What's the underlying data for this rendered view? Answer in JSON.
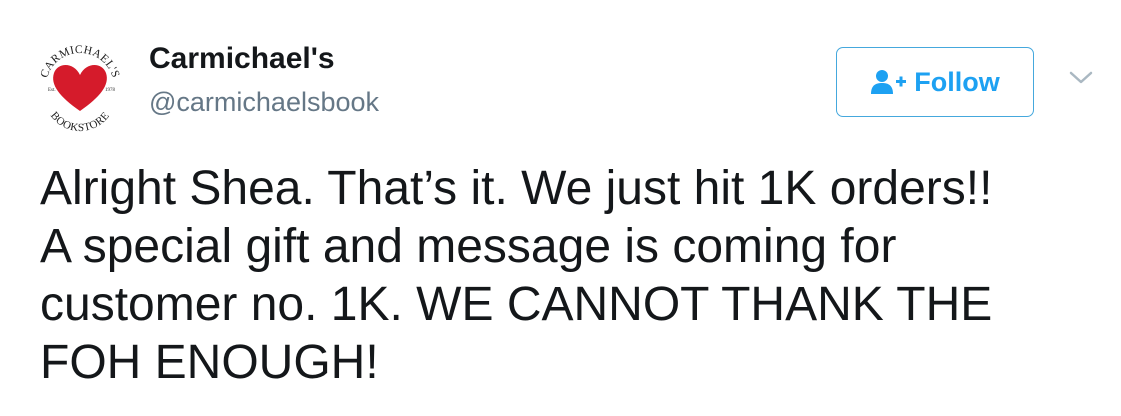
{
  "author": {
    "name": "Carmichael's",
    "handle": "@carmichaelsbook",
    "avatar": {
      "top_text": "CARMICHAEL'S",
      "bottom_text": "BOOKSTORE",
      "left_text": "Est.",
      "right_text": "1978",
      "heart_color": "#d51b2b"
    }
  },
  "follow_button": {
    "label": "Follow",
    "icon": "add-user-icon",
    "accent": "#1da1f2"
  },
  "menu": {
    "icon": "chevron-down-icon"
  },
  "tweet": {
    "text": "Alright Shea. That’s it. We just hit 1K orders!!\nA special gift and message is coming for\ncustomer no. 1K. WE CANNOT THANK THE\nFOH ENOUGH!"
  }
}
